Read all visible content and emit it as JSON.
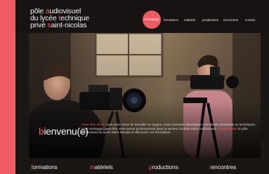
{
  "logo": {
    "line1_first": "p",
    "line1_rest": "ôle ",
    "line1_accent": "a",
    "line1_end": "udiovisuel",
    "line2_first": "du lycée ",
    "line2_accent": "t",
    "line2_end": "echnique",
    "line3_first": "privé ",
    "line3_accent": "s",
    "line3_end": "aint-nicolas"
  },
  "nav": {
    "active": "homepage",
    "items": [
      "formations",
      "matériel",
      "productions",
      "rencontres",
      "contact"
    ]
  },
  "hero": {
    "title_first": "b",
    "title_rest": "ienvenu(e)",
    "text_intro": "Vous êtes élève",
    "text_body": ", vous avez envie de travailler en équipe, vous souhaitez développer vos talents artistiques ou techniques, vous envisagez peut-être votre avenir professionnel dans le secteur Cinéma et/ou Audiovisuel... ",
    "text_link": "Venez visiter",
    "text_end": " le pôle audiovisuel du lycée Saint-Nicolas et découvrir nos formations."
  },
  "categories": [
    {
      "first": "f",
      "rest": "ormations"
    },
    {
      "first": "m",
      "rest": "atériels"
    },
    {
      "first": "p",
      "rest": "roductions"
    },
    {
      "first": "r",
      "rest": "encontres"
    }
  ],
  "colors": {
    "accent": "#ef5a6a",
    "background": "#1a1614",
    "strip": "#ee5b63"
  }
}
